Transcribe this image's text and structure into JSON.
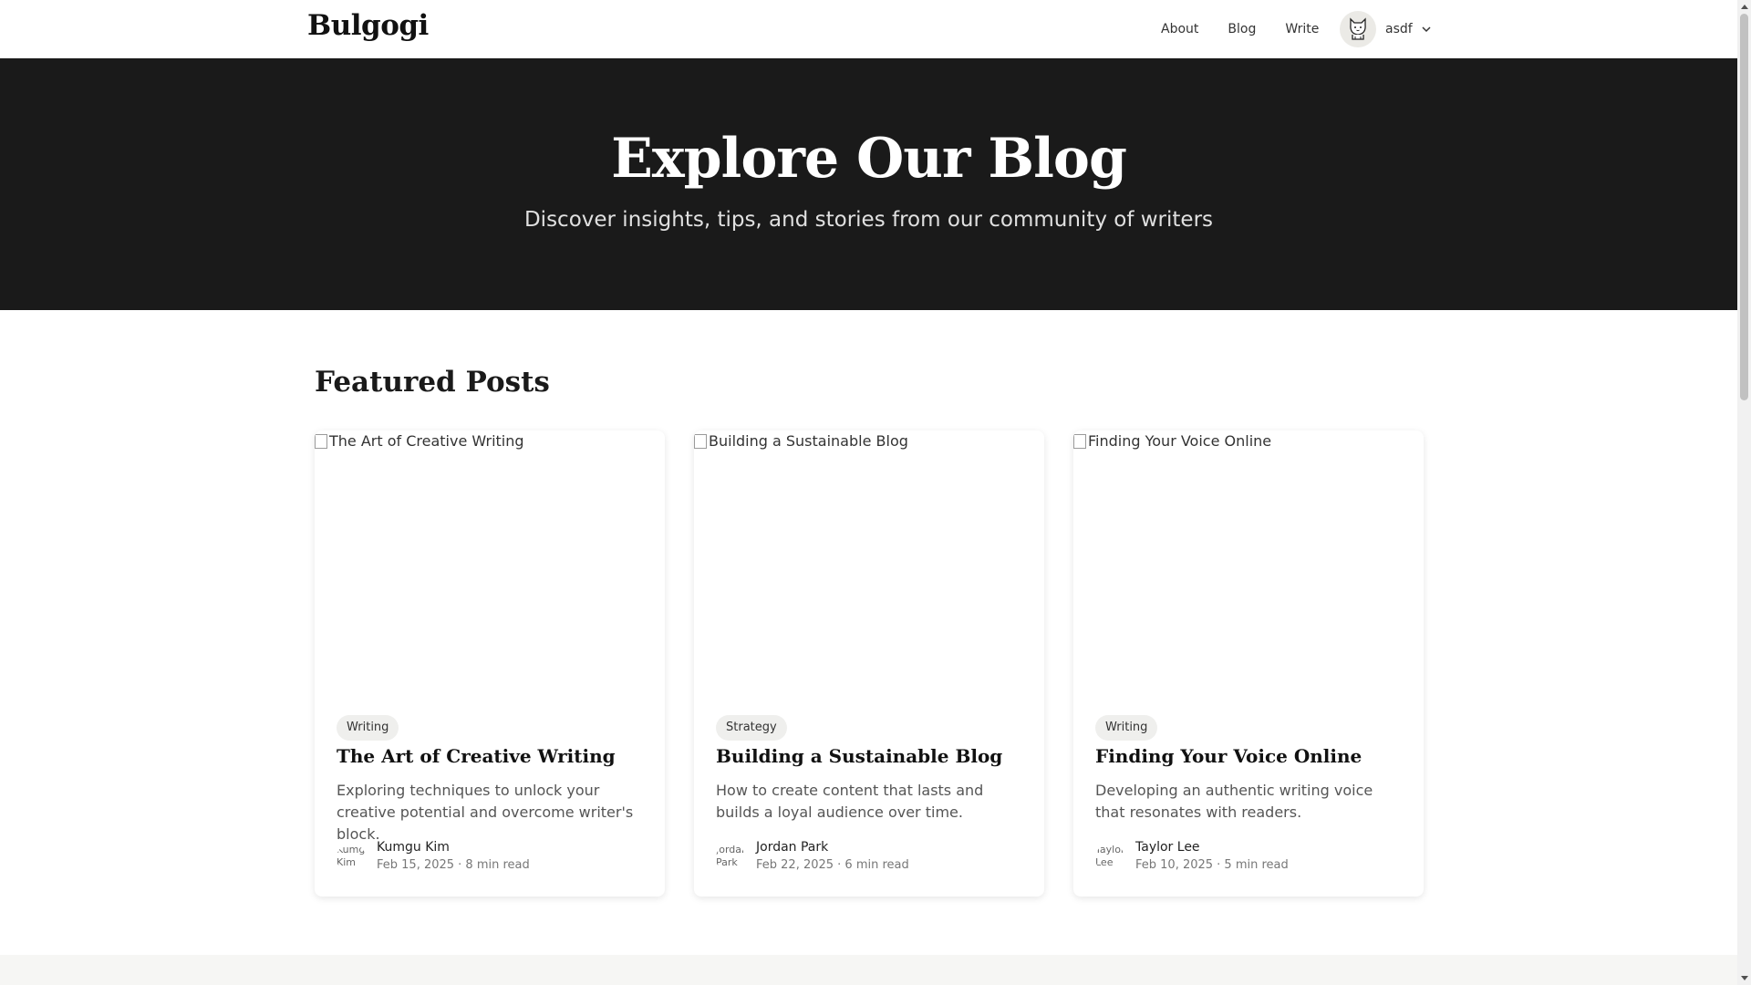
{
  "header": {
    "brand": "Bulgogi",
    "nav": [
      "About",
      "Blog",
      "Write"
    ],
    "username": "asdf"
  },
  "hero": {
    "title": "Explore Our Blog",
    "subtitle": "Discover insights, tips, and stories from our community of writers"
  },
  "featured": {
    "title": "Featured Posts",
    "posts": [
      {
        "image_alt": "The Art of Creative Writing",
        "tag": "Writing",
        "title": "The Art of Creative Writing",
        "description": "Exploring techniques to unlock your creative potential and overcome writer's block.",
        "author": "Kumgu Kim",
        "author_alt": "Kumgu Kim",
        "meta": "Feb 15, 2025 · 8 min read"
      },
      {
        "image_alt": "Building a Sustainable Blog",
        "tag": "Strategy",
        "title": "Building a Sustainable Blog",
        "description": "How to create content that lasts and builds a loyal audience over time.",
        "author": "Jordan Park",
        "author_alt": "Jordan Park",
        "meta": "Feb 22, 2025 · 6 min read"
      },
      {
        "image_alt": "Finding Your Voice Online",
        "tag": "Writing",
        "title": "Finding Your Voice Online",
        "description": "Developing an authentic writing voice that resonates with readers.",
        "author": "Taylor Lee",
        "author_alt": "Taylor Lee",
        "meta": "Feb 10, 2025 · 5 min read"
      }
    ]
  },
  "colors": {
    "hero_bg": "#1a1a1a",
    "tag_bg": "#efefed",
    "text_dark": "#111111"
  },
  "icons": {
    "user_avatar": "cat-avatar-icon",
    "dropdown": "chevron-down-icon",
    "broken_image": "broken-image-icon"
  }
}
